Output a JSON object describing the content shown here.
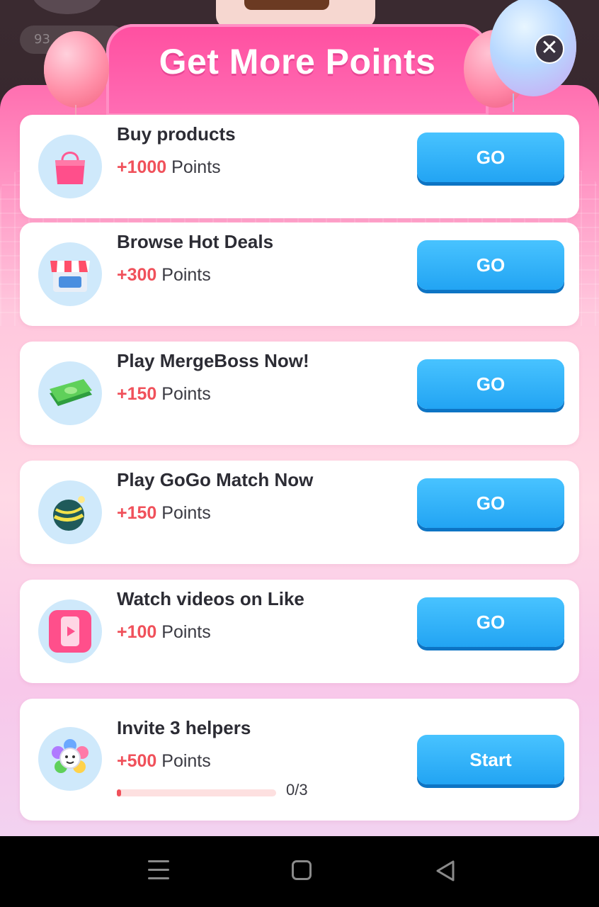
{
  "background": {
    "pill_text": "93"
  },
  "modal": {
    "title": "Get More Points",
    "close_icon": "close-icon",
    "accent_color": "#ff4fa0"
  },
  "tasks": [
    {
      "title": "Buy products",
      "points_value": "+1000",
      "points_unit": "Points",
      "button": "GO",
      "icon": "shopping-bag-icon"
    },
    {
      "title": "Browse Hot Deals",
      "points_value": "+300",
      "points_unit": "Points",
      "button": "GO",
      "icon": "storefront-icon"
    },
    {
      "title": "Play MergeBoss Now!",
      "points_value": "+150",
      "points_unit": "Points",
      "button": "GO",
      "icon": "cash-stack-icon"
    },
    {
      "title": "Play GoGo Match Now",
      "points_value": "+150",
      "points_unit": "Points",
      "button": "GO",
      "icon": "bomb-icon"
    },
    {
      "title": "Watch videos on Like",
      "points_value": "+100",
      "points_unit": "Points",
      "button": "GO",
      "icon": "video-phone-icon"
    },
    {
      "title": "Invite 3 helpers",
      "points_value": "+500",
      "points_unit": "Points",
      "button": "Start",
      "icon": "helpers-flower-icon",
      "progress_text": "0/3",
      "progress_fraction": 0.0
    }
  ],
  "colors": {
    "button": "#22a4f3",
    "points": "#f0515b"
  },
  "navbar": {
    "icons": [
      "menu-icon",
      "home-icon",
      "back-icon"
    ]
  }
}
